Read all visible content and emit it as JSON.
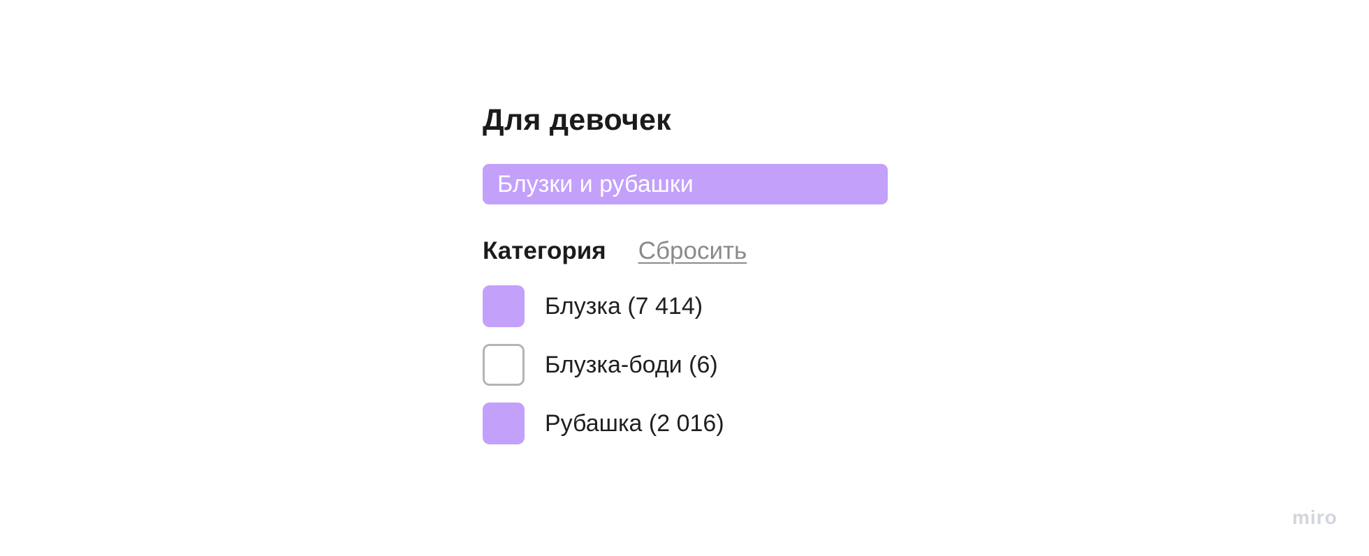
{
  "section": {
    "title": "Для девочек"
  },
  "chip": {
    "label": "Блузки и рубашки",
    "accent_color": "#c3a0fa"
  },
  "filter": {
    "title": "Категория",
    "reset_label": "Сбросить",
    "options": [
      {
        "label": "Блузка (7 414)",
        "checked": true
      },
      {
        "label": "Блузка-боди (6)",
        "checked": false
      },
      {
        "label": "Рубашка (2 016)",
        "checked": true
      }
    ]
  },
  "watermark": {
    "text": "miro"
  }
}
